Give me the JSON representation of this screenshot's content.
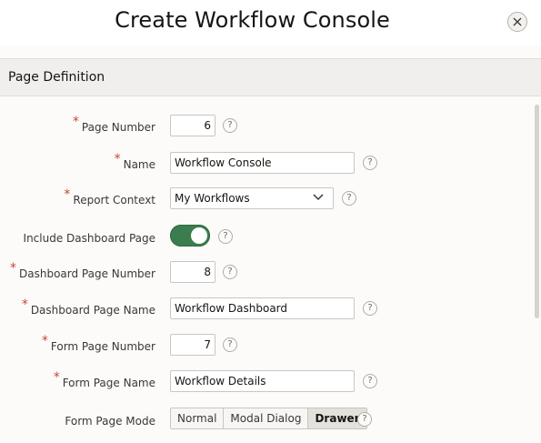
{
  "dialog": {
    "title": "Create Workflow Console"
  },
  "section": {
    "title": "Page Definition"
  },
  "fields": {
    "page_number": {
      "label": "Page Number",
      "value": "6"
    },
    "name": {
      "label": "Name",
      "value": "Workflow Console"
    },
    "report_context": {
      "label": "Report Context",
      "value": "My Workflows"
    },
    "include_dashboard": {
      "label": "Include Dashboard Page",
      "state": "on"
    },
    "dashboard_page_number": {
      "label": "Dashboard Page Number",
      "value": "8"
    },
    "dashboard_page_name": {
      "label": "Dashboard Page Name",
      "value": "Workflow Dashboard"
    },
    "form_page_number": {
      "label": "Form Page Number",
      "value": "7"
    },
    "form_page_name": {
      "label": "Form Page Name",
      "value": "Workflow Details"
    },
    "form_page_mode": {
      "label": "Form Page Mode",
      "options": [
        "Normal",
        "Modal Dialog",
        "Drawer"
      ],
      "selected": "Drawer"
    }
  },
  "help_glyph": "?",
  "required_marker": "*",
  "colors": {
    "toggle_on": "#3b7d4f",
    "required": "#c74634",
    "section_bg": "#f1efed"
  }
}
